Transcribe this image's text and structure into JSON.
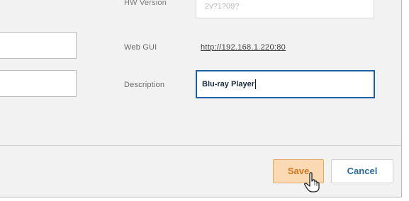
{
  "fields": {
    "hw_version": {
      "label": "HW Version",
      "value": "2v?1?09?"
    },
    "web_gui": {
      "label": "Web GUI",
      "url": "http://192.168.1.220:80"
    },
    "description": {
      "label": "Description",
      "value": "Blu-ray Player"
    }
  },
  "actions": {
    "save_label": "Save",
    "cancel_label": "Cancel"
  },
  "colors": {
    "panel_bg": "#f2f2f2",
    "focus_border": "#1f5fa8",
    "save_bg": "#fbd9b3",
    "save_text": "#d4781e",
    "cancel_text": "#2a6aa8"
  },
  "icons": {
    "pointer": "hand-pointer-icon"
  }
}
